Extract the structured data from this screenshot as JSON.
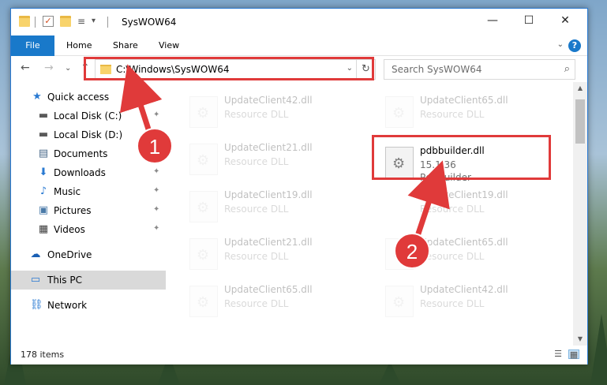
{
  "window": {
    "title": "SysWOW64",
    "minimize_glyph": "—",
    "maximize_glyph": "☐",
    "close_glyph": "✕"
  },
  "ribbon": {
    "tabs": [
      "File",
      "Home",
      "Share",
      "View"
    ],
    "expand_glyph": "⌄",
    "help_glyph": "?"
  },
  "nav_buttons": {
    "back": "←",
    "forward": "→",
    "recent": "⌄",
    "up": "↑"
  },
  "address": {
    "path": "C:\\Windows\\SysWOW64",
    "dropdown_glyph": "⌄",
    "refresh_glyph": "↻"
  },
  "search": {
    "placeholder": "Search SysWOW64",
    "icon_glyph": "⌕"
  },
  "sidebar": {
    "items": [
      {
        "label": "Quick access",
        "icon": "star-icon",
        "glyph": "★",
        "color": "#2a7ad2"
      },
      {
        "label": "Local Disk (C:)",
        "icon": "drive-windows-icon",
        "glyph": "▬",
        "color": "#5a5a5a"
      },
      {
        "label": "Local Disk (D:)",
        "icon": "drive-icon",
        "glyph": "▬",
        "color": "#5a5a5a"
      },
      {
        "label": "Documents",
        "icon": "documents-icon",
        "glyph": "▤",
        "color": "#4a6a8a"
      },
      {
        "label": "Downloads",
        "icon": "download-icon",
        "glyph": "⬇",
        "color": "#2a7ad2"
      },
      {
        "label": "Music",
        "icon": "music-icon",
        "glyph": "♪",
        "color": "#2a7ad2"
      },
      {
        "label": "Pictures",
        "icon": "pictures-icon",
        "glyph": "▣",
        "color": "#4a7aa8"
      },
      {
        "label": "Videos",
        "icon": "videos-icon",
        "glyph": "▦",
        "color": "#3c3c3c"
      },
      {
        "label": "OneDrive",
        "icon": "onedrive-icon",
        "glyph": "☁",
        "color": "#1a5fb4"
      },
      {
        "label": "This PC",
        "icon": "pc-icon",
        "glyph": "▭",
        "color": "#2a7ad2"
      },
      {
        "label": "Network",
        "icon": "network-icon",
        "glyph": "⛓",
        "color": "#2a7ad2"
      }
    ],
    "pin_glyph": "✦"
  },
  "files": {
    "faded": [
      {
        "name": "UpdateClient42.dll",
        "sub": "Resource DLL"
      },
      {
        "name": "UpdateClient65.dll",
        "sub": "Resource DLL"
      },
      {
        "name": "UpdateClient21.dll",
        "sub": "Resource DLL"
      },
      {
        "name": "UpdateClient19.dll",
        "sub": "Resource DLL"
      },
      {
        "name": "UpdateClient19.dll",
        "sub": "Resource DLL"
      },
      {
        "name": "UpdateClient21.dll",
        "sub": "Resource DLL"
      },
      {
        "name": "UpdateClient65.dll",
        "sub": "Resource DLL"
      },
      {
        "name": "UpdateClient65.dll",
        "sub": "Resource DLL"
      },
      {
        "name": "UpdateClient42.dll",
        "sub": "Resource DLL"
      }
    ],
    "target": {
      "name": "pdbbuilder.dll",
      "version": "15.1.36",
      "description": "PdbBuilder"
    },
    "gear_glyph": "⚙"
  },
  "status": {
    "item_count": "178 items",
    "details_glyph": "☰",
    "tiles_glyph": "▦"
  },
  "annotations": {
    "step1": "1",
    "step2": "2",
    "color": "#e03a3a"
  },
  "scroll": {
    "up_glyph": "▲",
    "down_glyph": "▼"
  }
}
